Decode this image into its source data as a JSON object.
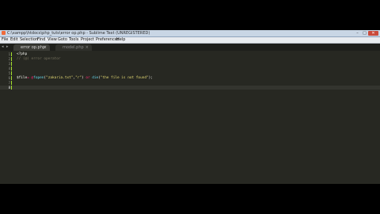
{
  "window": {
    "title": "C:\\xampp\\htdocs\\php_tuts\\error op.php - Sublime Text (UNREGISTERED)",
    "controls": {
      "minimize": "–",
      "maximize": "□",
      "close": "✕"
    }
  },
  "menu": [
    "File",
    "Edit",
    "Selection",
    "Find",
    "View",
    "Goto",
    "Tools",
    "Project",
    "Preferences",
    "Help"
  ],
  "tabs": {
    "nav_left": "◂",
    "nav_right": "▸",
    "items": [
      {
        "label": "error op.php",
        "close": "×",
        "active": true
      },
      {
        "label": "model.php",
        "close": "×",
        "active": false
      }
    ]
  },
  "editor": {
    "line_numbers": [
      "1",
      "2",
      "3",
      "4",
      "5",
      "6",
      "7",
      "8"
    ],
    "current_line": 8,
    "lines": [
      {
        "tokens": [
          {
            "t": "<?php",
            "c": "tag"
          }
        ]
      },
      {
        "tokens": [
          {
            "t": "// (@) error operator",
            "c": "comment"
          }
        ]
      },
      {
        "tokens": []
      },
      {
        "tokens": []
      },
      {
        "tokens": []
      },
      {
        "tokens": [
          {
            "t": "$file",
            "c": "var"
          },
          {
            "t": "= ",
            "c": "op"
          },
          {
            "t": "@",
            "c": "op"
          },
          {
            "t": "fopen",
            "c": "func"
          },
          {
            "t": "(",
            "c": "punc"
          },
          {
            "t": "\"zakaria.txt\"",
            "c": "str"
          },
          {
            "t": ",",
            "c": "punc"
          },
          {
            "t": "\"r\"",
            "c": "str"
          },
          {
            "t": ") ",
            "c": "punc"
          },
          {
            "t": "or ",
            "c": "op"
          },
          {
            "t": "die",
            "c": "func"
          },
          {
            "t": "(",
            "c": "punc"
          },
          {
            "t": "\"the file is not found\"",
            "c": "str"
          },
          {
            "t": ");",
            "c": "punc"
          }
        ]
      },
      {
        "tokens": []
      },
      {
        "tokens": []
      }
    ]
  },
  "colors": {
    "background": "#272822",
    "comment": "#75715e",
    "keyword": "#f92672",
    "string": "#e6db74",
    "function": "#66d9ef"
  }
}
